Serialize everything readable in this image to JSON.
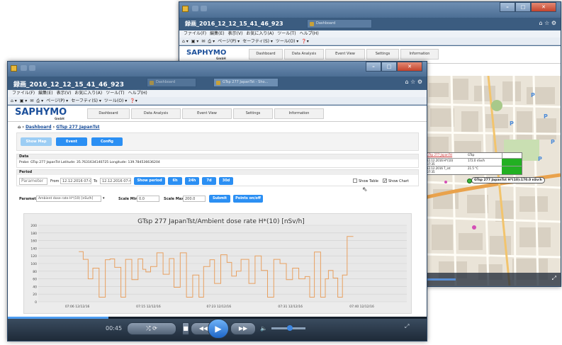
{
  "windows": {
    "back": {
      "title": "録画_2016_12_12_15_41_46_923",
      "tab_label": "Dashboard",
      "menu": [
        "ファイル(F)",
        "編集(E)",
        "表示(V)",
        "お気に入り(A)",
        "ツール(T)",
        "ヘルプ(H)"
      ],
      "cmd": [
        "ページ(P) ▾",
        "セーフティ(S) ▾",
        "ツール(O) ▾"
      ],
      "nav": [
        "Dashboard",
        "Data Analysis",
        "Event View",
        "Settings",
        "Information"
      ],
      "popup": {
        "rows": [
          [
            "GTsp 277 JapanTst",
            "GTsp",
            ""
          ],
          [
            "12.12.2016 07:35",
            "H*(10)",
            "172.0 nSv/h"
          ],
          [
            "12.12.2016 07:35",
            "T_int",
            "21.5 °C"
          ]
        ],
        "marker_label": "GTsp 277 JapanTst  H*(10):170.0 nSv/h"
      }
    },
    "front": {
      "title": "録画_2016_12_12_15_41_46_923",
      "tab1": "GTsp 277 JapanTst - Sho...",
      "tab2": "Dashboard",
      "menu": [
        "ファイル(F)",
        "編集(E)",
        "表示(V)",
        "お気に入り(A)",
        "ツール(T)",
        "ヘルプ(H)"
      ],
      "cmd": [
        "ページ(P) ▾",
        "セーフティ(S) ▾",
        "ツール(O) ▾"
      ]
    }
  },
  "logo": {
    "text": "SAPHYMO",
    "sub": "GmbH"
  },
  "nav": [
    "Dashboard",
    "Data Analysis",
    "Event View",
    "Settings",
    "Information"
  ],
  "breadcrumb": {
    "home": "Dashboard",
    "sep": "›",
    "current": "GTsp 277 JapanTst"
  },
  "buttons": {
    "show_map": "Show Map",
    "event": "Event",
    "config": "Config"
  },
  "data_section": {
    "heading": "Data",
    "probe": "Probe: GTsp 277 JapanTst Latitude: 35.7631634140725 Longitude: 139.784536636204"
  },
  "period": {
    "heading": "Period",
    "parameter": "Parameter",
    "from_label": "From",
    "from_value": "12.12.2016 07:0(",
    "to_label": "To",
    "to_value": "12.12.2016 07:4(",
    "show_period": "Show period",
    "ranges": [
      "6h",
      "24h",
      "7d",
      "30d"
    ],
    "show_table": "Show Table",
    "show_chart": "Show Chart"
  },
  "param_row": {
    "label": "Parameter",
    "value": "Ambient dose rate H*(10) [nSv/h]",
    "scale_min_label": "Scale Min.",
    "scale_min": "0.0",
    "scale_max_label": "Scale Max.",
    "scale_max": "200.0",
    "submit": "Submit",
    "points": "Points on/off"
  },
  "player": {
    "time": "00:45"
  },
  "chart_data": {
    "type": "line",
    "title": "GTsp 277 JapanTst/Ambient dose rate H*(10) [nSv/h]",
    "ylim": [
      0,
      200
    ],
    "yticks": [
      0,
      20,
      40,
      60,
      80,
      100,
      120,
      140,
      160,
      180,
      200
    ],
    "xticks": [
      "07:06 12/12/16",
      "07:15 12/12/16",
      "07:23 12/12/16",
      "07:31 12/12/16",
      "07:40 12/12/16"
    ],
    "xtick_pos": [
      0.106,
      0.299,
      0.49,
      0.684,
      0.878
    ],
    "series": [
      {
        "x": [
          0.0,
          0.014,
          0.014,
          0.03,
          0.03,
          0.045,
          0.045,
          0.065,
          0.065,
          0.085,
          0.085,
          0.1,
          0.1,
          0.115,
          0.115,
          0.135,
          0.135,
          0.15,
          0.15,
          0.17,
          0.17,
          0.19,
          0.19,
          0.205,
          0.205,
          0.215,
          0.215,
          0.23,
          0.23,
          0.25,
          0.25,
          0.27,
          0.27,
          0.29,
          0.29,
          0.305,
          0.305,
          0.325,
          0.325,
          0.345,
          0.345,
          0.365,
          0.365,
          0.385,
          0.385,
          0.4,
          0.4,
          0.42,
          0.42,
          0.435,
          0.435,
          0.455,
          0.455,
          0.475,
          0.475,
          0.49,
          0.49,
          0.505,
          0.505,
          0.52,
          0.52,
          0.545,
          0.545,
          0.565,
          0.565,
          0.585,
          0.585,
          0.605,
          0.605,
          0.625,
          0.625,
          0.645,
          0.645,
          0.665,
          0.665,
          0.685,
          0.685,
          0.705,
          0.705,
          0.725,
          0.725,
          0.74,
          0.74,
          0.755,
          0.755,
          0.775,
          0.775,
          0.79,
          0.79,
          0.8,
          0.8,
          0.815,
          0.815,
          0.83,
          0.83,
          0.845,
          0.845,
          0.86,
          0.86,
          0.88
        ],
        "y": [
          131,
          131,
          111,
          111,
          60,
          60,
          88,
          88,
          12,
          12,
          110,
          110,
          112,
          112,
          90,
          90,
          12,
          12,
          111,
          111,
          58,
          58,
          112,
          112,
          85,
          85,
          78,
          78,
          92,
          92,
          128,
          128,
          72,
          72,
          113,
          113,
          38,
          38,
          128,
          128,
          12,
          12,
          70,
          70,
          12,
          12,
          92,
          92,
          110,
          110,
          48,
          48,
          123,
          123,
          103,
          103,
          67,
          67,
          80,
          80,
          111,
          111,
          48,
          48,
          120,
          120,
          82,
          82,
          12,
          12,
          111,
          111,
          100,
          100,
          58,
          58,
          88,
          88,
          60,
          60,
          66,
          66,
          12,
          12,
          130,
          130,
          12,
          12,
          60,
          60,
          82,
          82,
          62,
          62,
          12,
          12,
          70,
          70,
          171,
          171
        ]
      }
    ]
  }
}
